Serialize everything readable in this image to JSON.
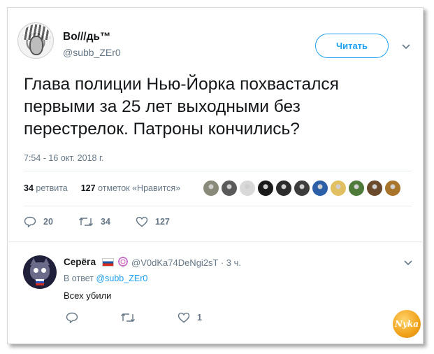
{
  "tweet": {
    "display_name": "Во///дь™",
    "handle": "@subb_ZEr0",
    "follow_label": "Читать",
    "text": "Глава полиции Нью-Йорка похвастался первыми за 25 лет выходными без перестрелок. Патроны кончились?",
    "timestamp": "7:54 - 16 окт. 2018 г.",
    "retweets_count": "34",
    "retweets_label": "ретвита",
    "likes_count": "127",
    "likes_label": "отметок «Нравится»",
    "liker_colors": [
      "#8a8a7a",
      "#5a5a5a",
      "#d9d9d9",
      "#1a1a1a",
      "#2c2c2c",
      "#3d3d3d",
      "#2d5fa8",
      "#e0c060",
      "#4e7a3a",
      "#6a4a2a",
      "#a8752a"
    ],
    "actions": {
      "reply_count": "20",
      "retweet_count": "34",
      "like_count": "127"
    }
  },
  "reply": {
    "display_name": "Серёга",
    "handle_time": "@V0dKa74DeNgi2sT · 3 ч.",
    "reply_to_prefix": "В ответ",
    "reply_to_handle": "@subb_ZEr0",
    "text": "Всех убили",
    "actions": {
      "like_count": "1"
    }
  },
  "watermark_text": "Nyka",
  "colors": {
    "accent": "#1da1f2",
    "secondary_text": "#657786",
    "separator": "#e6ecf0"
  }
}
